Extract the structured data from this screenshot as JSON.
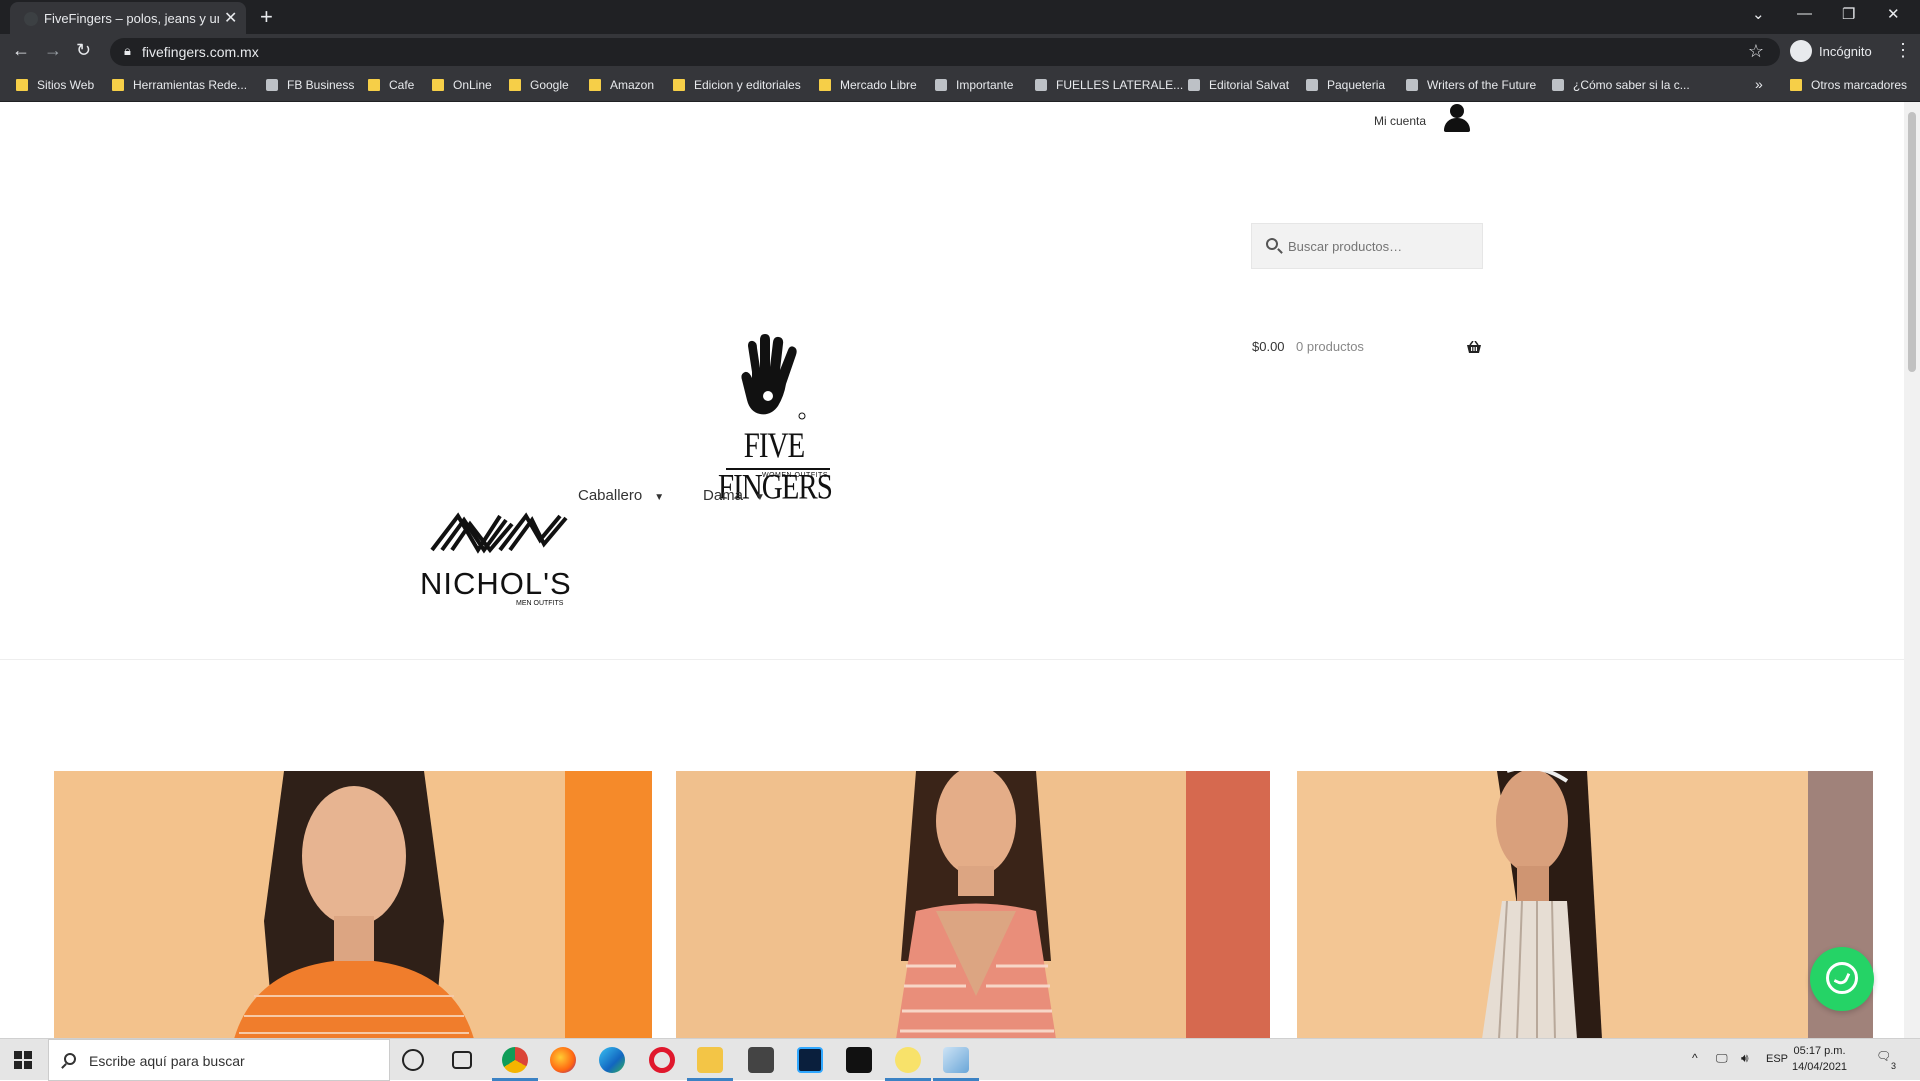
{
  "browser": {
    "tab_title": "FiveFingers – polos, jeans y unifo",
    "tab_close": "✕",
    "new_tab": "+",
    "url": "fivefingers.com.mx",
    "profile_label": "Incógnito",
    "window_controls": [
      "—",
      "❐",
      "✕"
    ]
  },
  "bookmarks": [
    {
      "label": "Sitios Web",
      "icon": "folder"
    },
    {
      "label": "Herramientas Rede...",
      "icon": "folder"
    },
    {
      "label": "FB Business",
      "icon": "page"
    },
    {
      "label": "Cafe",
      "icon": "folder"
    },
    {
      "label": "OnLine",
      "icon": "folder"
    },
    {
      "label": "Google",
      "icon": "folder"
    },
    {
      "label": "Amazon",
      "icon": "folder"
    },
    {
      "label": "Edicion y editoriales",
      "icon": "folder"
    },
    {
      "label": "Mercado Libre",
      "icon": "folder"
    },
    {
      "label": "Importante",
      "icon": "page"
    },
    {
      "label": "FUELLES LATERALE...",
      "icon": "page"
    },
    {
      "label": "Editorial Salvat",
      "icon": "page"
    },
    {
      "label": "Paqueteria",
      "icon": "page"
    },
    {
      "label": "Writers of the Future",
      "icon": "page"
    },
    {
      "label": "¿Cómo saber si la c...",
      "icon": "page"
    },
    {
      "label": "Otros marcadores",
      "icon": "folder"
    }
  ],
  "bookmarks_more": "»",
  "site": {
    "account_label": "Mi cuenta",
    "search_placeholder": "Buscar productos…",
    "cart_amount": "$0.00",
    "cart_count": "0 productos",
    "logo_main": "FIVE FINGERS",
    "logo_main_sub": "WOMEN OUTFITS",
    "logo_secondary": "NICHOL'S",
    "logo_secondary_sub": "MEN OUTFITS",
    "menu": [
      {
        "label": "Caballero"
      },
      {
        "label": "Dama"
      }
    ]
  },
  "taskbar": {
    "search_placeholder": "Escribe aquí para buscar",
    "language": "ESP",
    "time": "05:17 p.m.",
    "date": "14/04/2021",
    "notifications": "3"
  },
  "colors": {
    "chrome_dark": "#202124",
    "chrome_toolbar": "#35363a",
    "whatsapp": "#25d366",
    "product1_stripe": "#f58a2a",
    "product2_stripe": "#d6694f",
    "product3_stripe": "#a0827a"
  }
}
